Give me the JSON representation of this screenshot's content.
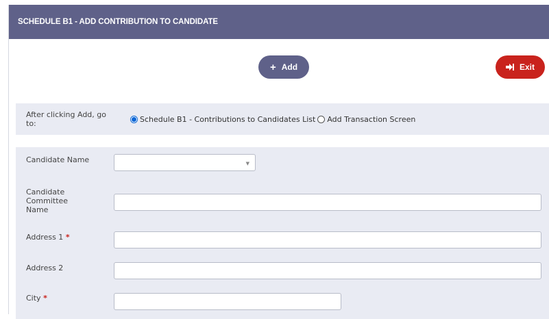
{
  "header": {
    "title": "SCHEDULE B1 - ADD CONTRIBUTION TO CANDIDATE"
  },
  "toolbar": {
    "add_label": "Add",
    "exit_label": "Exit"
  },
  "redirect": {
    "label": "After clicking Add, go to:",
    "options": [
      {
        "label": "Schedule B1 - Contributions to Candidates List",
        "checked": true
      },
      {
        "label": "Add Transaction Screen",
        "checked": false
      }
    ]
  },
  "form": {
    "candidate_name": {
      "label": "Candidate Name",
      "value": ""
    },
    "committee_name": {
      "label": "Candidate Committee Name",
      "value": ""
    },
    "address1": {
      "label": "Address 1",
      "required_mark": "*",
      "value": ""
    },
    "address2": {
      "label": "Address 2",
      "value": ""
    },
    "city": {
      "label": "City",
      "required_mark": "*",
      "value": ""
    }
  },
  "colors": {
    "header_bg": "#5f6189",
    "exit_red": "#c9231d",
    "radio_blue": "#0a66d6",
    "form_bg": "#e9ebf3"
  }
}
